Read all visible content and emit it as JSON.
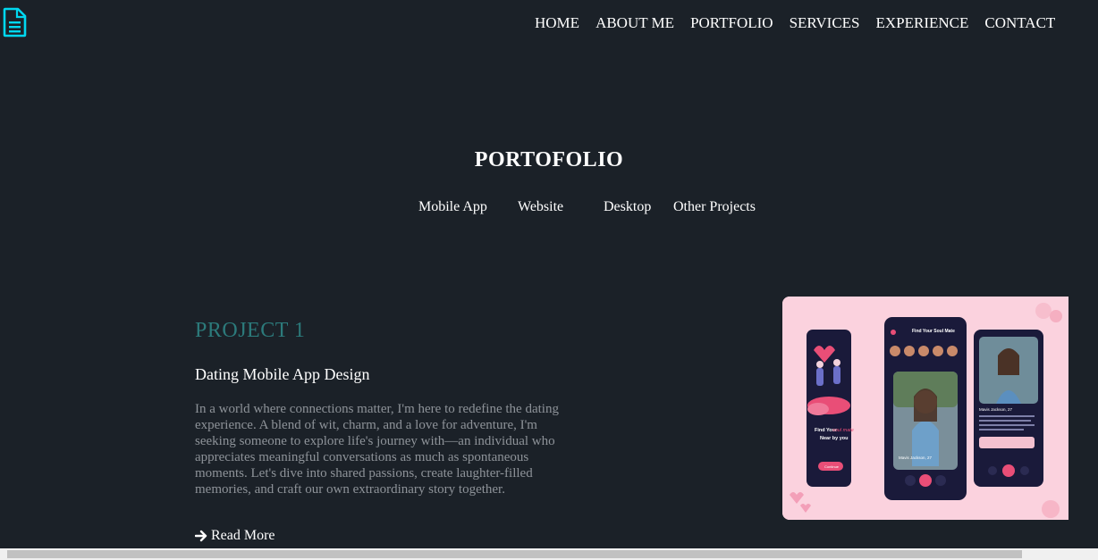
{
  "header": {
    "logo_icon": "document-icon",
    "accent_color": "#00d8f0",
    "nav": [
      {
        "label": "HOME"
      },
      {
        "label": "ABOUT ME"
      },
      {
        "label": "PORTFOLIO"
      },
      {
        "label": "SERVICES"
      },
      {
        "label": "EXPERIENCE"
      },
      {
        "label": "CONTACT"
      }
    ]
  },
  "portfolio": {
    "title": "PORTOFOLIO",
    "tabs": [
      {
        "label": "Mobile App"
      },
      {
        "label": "Website"
      },
      {
        "label": "Desktop"
      },
      {
        "label": "Other Projects"
      }
    ]
  },
  "project": {
    "kicker": "PROJECT 1",
    "title": "Dating Mobile App Design",
    "description": "In a world where connections matter, I'm here to redefine the dating experience. A blend of wit, charm, and a love for adventure, I'm seeking someone to explore life's journey with—an individual who appreciates meaningful conversations as much as spontaneous moments. Let's dive into shared passions, create laughter-filled memories, and craft our own extraordinary story together.",
    "read_more": "Read More",
    "read_more_icon": "arrow-right-icon",
    "kicker_color": "#2c7a7b",
    "mockup": {
      "background_color": "#fbd2de",
      "accent_color": "#e94e77",
      "screen1_line1": "Find Your",
      "screen1_line2": "soul mate",
      "screen1_line3": "Near by you",
      "screen1_button": "Continue",
      "screen2_header": "Find Your Soul Mate",
      "screen2_name": "Mavis Jackson, 27",
      "screen3_name": "Mavis Jackson, 27"
    }
  }
}
